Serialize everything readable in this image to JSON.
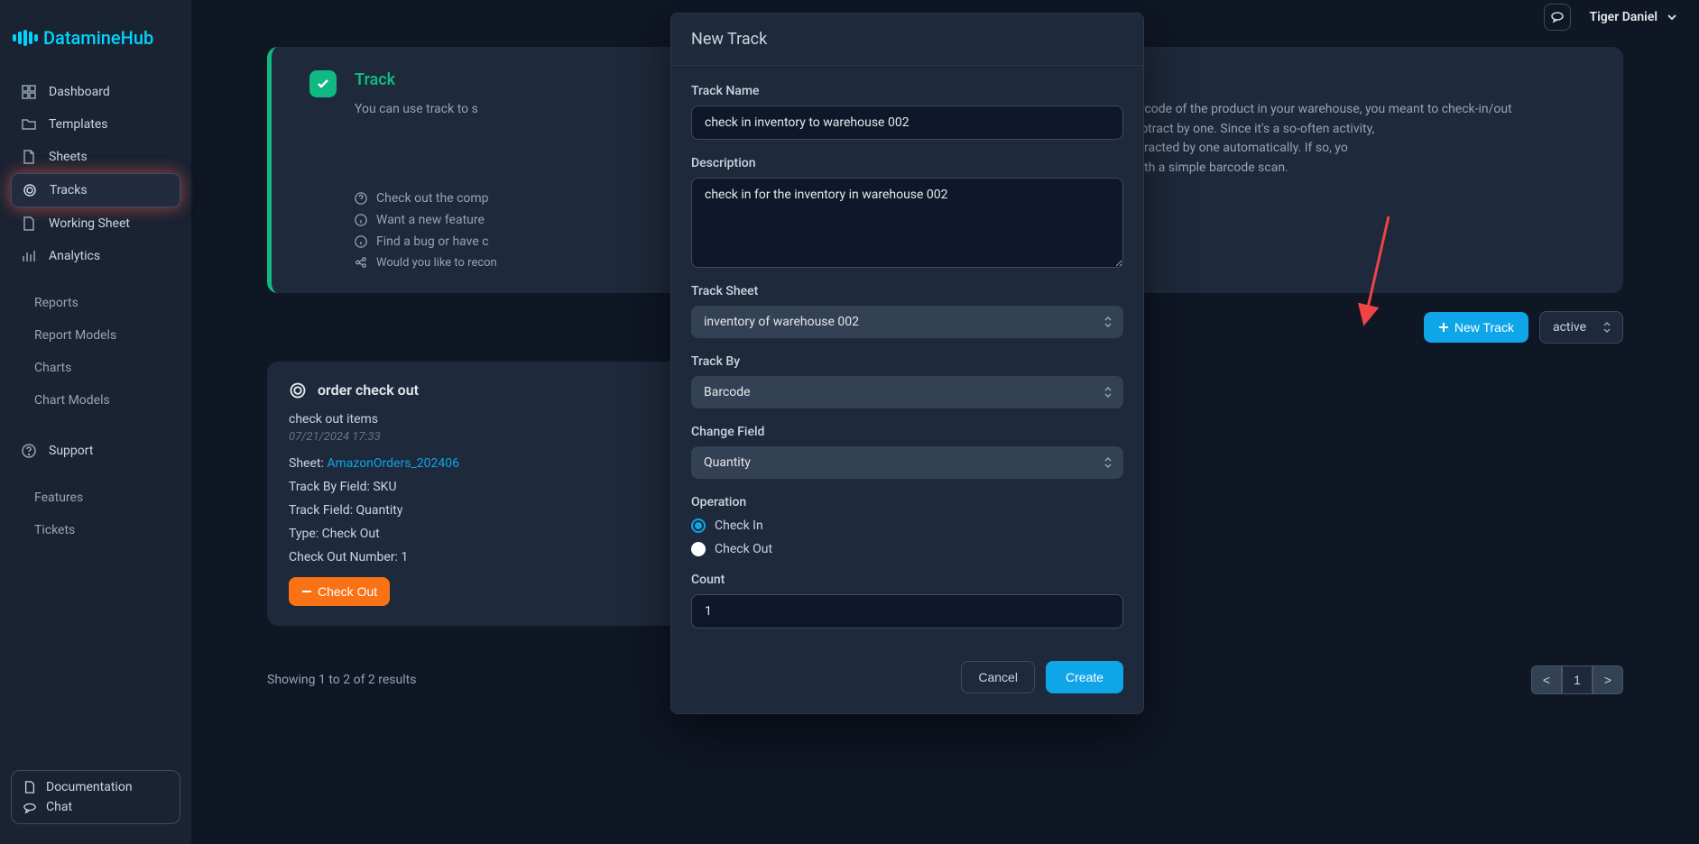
{
  "app_name": "DatamineHub",
  "user_name": "Tiger Daniel",
  "sidebar": {
    "main": [
      {
        "label": "Dashboard",
        "icon": "dashboard"
      },
      {
        "label": "Templates",
        "icon": "folder"
      },
      {
        "label": "Sheets",
        "icon": "file"
      },
      {
        "label": "Tracks",
        "icon": "target"
      },
      {
        "label": "Working Sheet",
        "icon": "file"
      },
      {
        "label": "Analytics",
        "icon": "bars"
      }
    ],
    "sub": [
      {
        "label": "Reports"
      },
      {
        "label": "Report Models"
      },
      {
        "label": "Charts"
      },
      {
        "label": "Chart Models"
      }
    ],
    "support_label": "Support",
    "support_sub": [
      {
        "label": "Features"
      },
      {
        "label": "Tickets"
      }
    ],
    "doc_label": "Documentation",
    "chat_label": "Chat"
  },
  "info": {
    "title": "Track",
    "body_a": "You can use track to s",
    "body_b": "n you scan the barcode of the product in your warehouse, you meant to check-in/out",
    "body_c": "tity field value to new one, either add or subtract by one. Since it's a so-often activity,",
    "body_d": "uantity of that item will be added/subtracted by one automatically. If so, yo",
    "body_e": " quantity tracking operations with a simple barcode scan.",
    "links": [
      "Check out the comp",
      "Want a new feature",
      "Find a bug or have c",
      "Would you like to recon"
    ]
  },
  "actions": {
    "new_track": "New Track",
    "filter_value": "active"
  },
  "card": {
    "title": "order check out",
    "desc": "check out items",
    "time": "07/21/2024 17:33",
    "sheet_label": "Sheet:",
    "sheet_link": "AmazonOrders_202406",
    "track_by": "Track By Field: SKU",
    "track_field": "Track Field: Quantity",
    "type": "Type: Check Out",
    "checkout_num": "Check Out Number: 1",
    "btn": "Check Out"
  },
  "footer": {
    "showing": "Showing 1 to 2 of 2 results",
    "prev": "<",
    "page": "1",
    "next": ">"
  },
  "modal": {
    "title": "New Track",
    "name_label": "Track Name",
    "name_value": "check in inventory to warehouse 002",
    "desc_label": "Description",
    "desc_value": "check in for the inventory in warehouse 002",
    "sheet_label": "Track Sheet",
    "sheet_value": "inventory of warehouse 002",
    "trackby_label": "Track By",
    "trackby_value": "Barcode",
    "change_label": "Change Field",
    "change_value": "Quantity",
    "op_label": "Operation",
    "op_in": "Check In",
    "op_out": "Check Out",
    "count_label": "Count",
    "count_value": "1",
    "cancel": "Cancel",
    "create": "Create"
  }
}
